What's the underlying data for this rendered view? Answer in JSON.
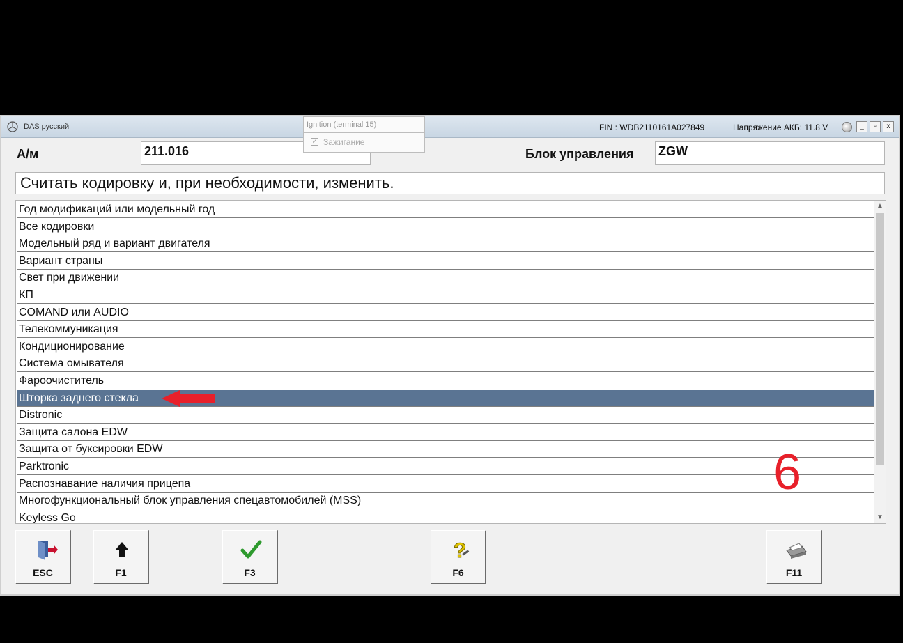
{
  "window": {
    "title": "DAS русский",
    "fin": "FIN : WDB2110161A027849",
    "voltage": "Напряжение АКБ: 11.8 V",
    "controls": [
      "_",
      "▫",
      "x"
    ]
  },
  "popup": {
    "title": "Ignition (terminal 15)",
    "item_label": "Зажигание",
    "checked": true
  },
  "header": {
    "vehicle_label": "А/м",
    "vehicle_value": "211.016",
    "ecu_label": "Блок управления",
    "ecu_value": "ZGW"
  },
  "description": "Считать кодировку и, при необходимости, изменить.",
  "list": {
    "items": [
      "Год модификаций или модельный год",
      "Все кодировки",
      "Модельный ряд и вариант двигателя",
      "Вариант страны",
      "Свет при движении",
      "КП",
      "COMAND или AUDIO",
      "Телекоммуникация",
      "Кондиционирование",
      "Система омывателя",
      "Фароочиститель",
      "Шторка заднего стекла",
      "Distronic",
      "Защита салона EDW",
      "Защита от буксировки EDW",
      "Parktronic",
      "Распознавание наличия прицепа",
      "Многофункциональный блок управления спецавтомобилей (MSS)",
      "Keyless Go"
    ],
    "selected_index": 11
  },
  "annotation": "6",
  "buttons": {
    "esc": "ESC",
    "f1": "F1",
    "f3": "F3",
    "f6": "F6",
    "f11": "F11"
  },
  "colors": {
    "selected_row": "#5a7493",
    "annotation": "#e8202a",
    "check": "#2e9a2e"
  }
}
